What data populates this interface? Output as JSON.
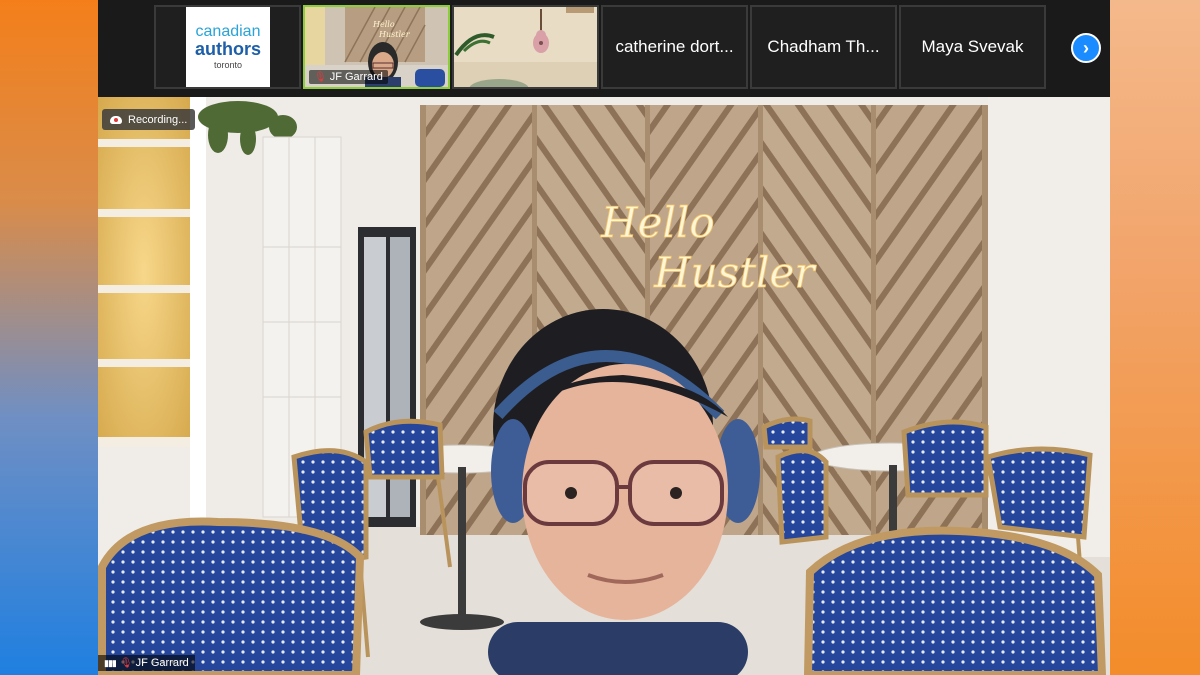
{
  "filmstrip": {
    "tiles": [
      {
        "kind": "logo",
        "logo_line1": "canadian",
        "logo_line2": "authors",
        "logo_line3": "toronto"
      },
      {
        "kind": "video",
        "name": "JF Garrard",
        "active": true
      },
      {
        "kind": "video",
        "name": ""
      },
      {
        "kind": "name",
        "name": "catherine dort..."
      },
      {
        "kind": "name",
        "name": "Chadham Th..."
      },
      {
        "kind": "name",
        "name": "Maya Svevak"
      }
    ],
    "next_icon": "chevron-right-icon"
  },
  "main": {
    "recording_label": "Recording...",
    "speaker_name": "JF Garrard",
    "sign_line1": "Hello",
    "sign_line2": "Hustler"
  },
  "colors": {
    "active_border": "#8ccd3a",
    "next_button": "#1a8cff",
    "chair_blue": "#2b4fa0",
    "mic_muted": "#e23b3b"
  }
}
